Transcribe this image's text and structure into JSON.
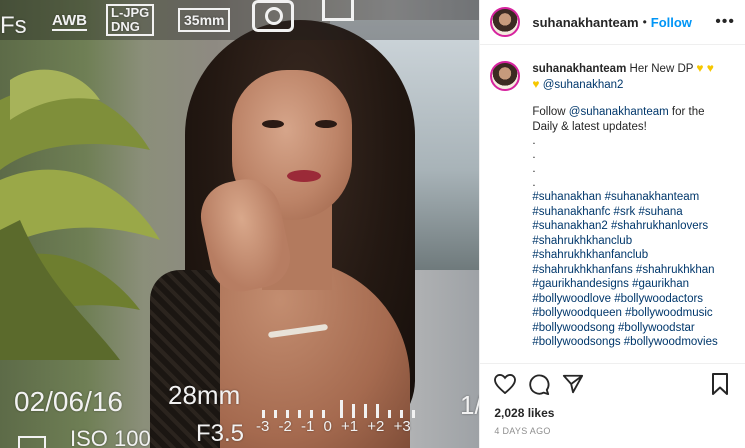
{
  "photo": {
    "alt_subject": "portrait-photo",
    "hud": {
      "fs": "Fs",
      "awb": "AWB",
      "jpg": "L-JPG",
      "dng": "DNG",
      "lens_top": "35mm",
      "date": "02/06/16",
      "focal": "28mm",
      "aperture": "F3.5",
      "iso": "ISO 100",
      "ev_scale": "-3 -2 -1 0 +1 +2 +3",
      "edge": "1/"
    }
  },
  "header": {
    "username": "suhanakhanteam",
    "separator": "•",
    "follow_label": "Follow",
    "more_label": "•••"
  },
  "caption": {
    "username": "suhanakhanteam",
    "text1": "Her New DP",
    "mention": "@suhanakhan2",
    "follow_prefix": "Follow ",
    "follow_mention": "@suhanakhanteam",
    "follow_suffix": " for the Daily & latest updates!",
    "dots": [
      ".",
      ".",
      ".",
      "."
    ],
    "hashtags": [
      "#suhanakhan #suhanakhanteam",
      "#suhanakhanfc #srk #suhana",
      "#suhanakhan2 #shahrukhanlovers",
      "#shahrukhkhanclub",
      "#shahrukhkhanfanclub",
      "#shahrukhkhanfans #shahrukhkhan",
      "#gaurikhandesigns #gaurikhan",
      "#bollywoodlove #bollywoodactors",
      "#bollywoodqueen #bollywoodmusic",
      "#bollywoodsong #bollywoodstar",
      "#bollywoodsongs #bollywoodmovies"
    ]
  },
  "stats": {
    "likes": "2,028 likes",
    "time_ago": "4 DAYS AGO"
  },
  "colors": {
    "accent": "#0095f6",
    "text": "#262626",
    "link": "#00376b",
    "muted": "#8e8e8e",
    "heart": "#f6c700"
  }
}
